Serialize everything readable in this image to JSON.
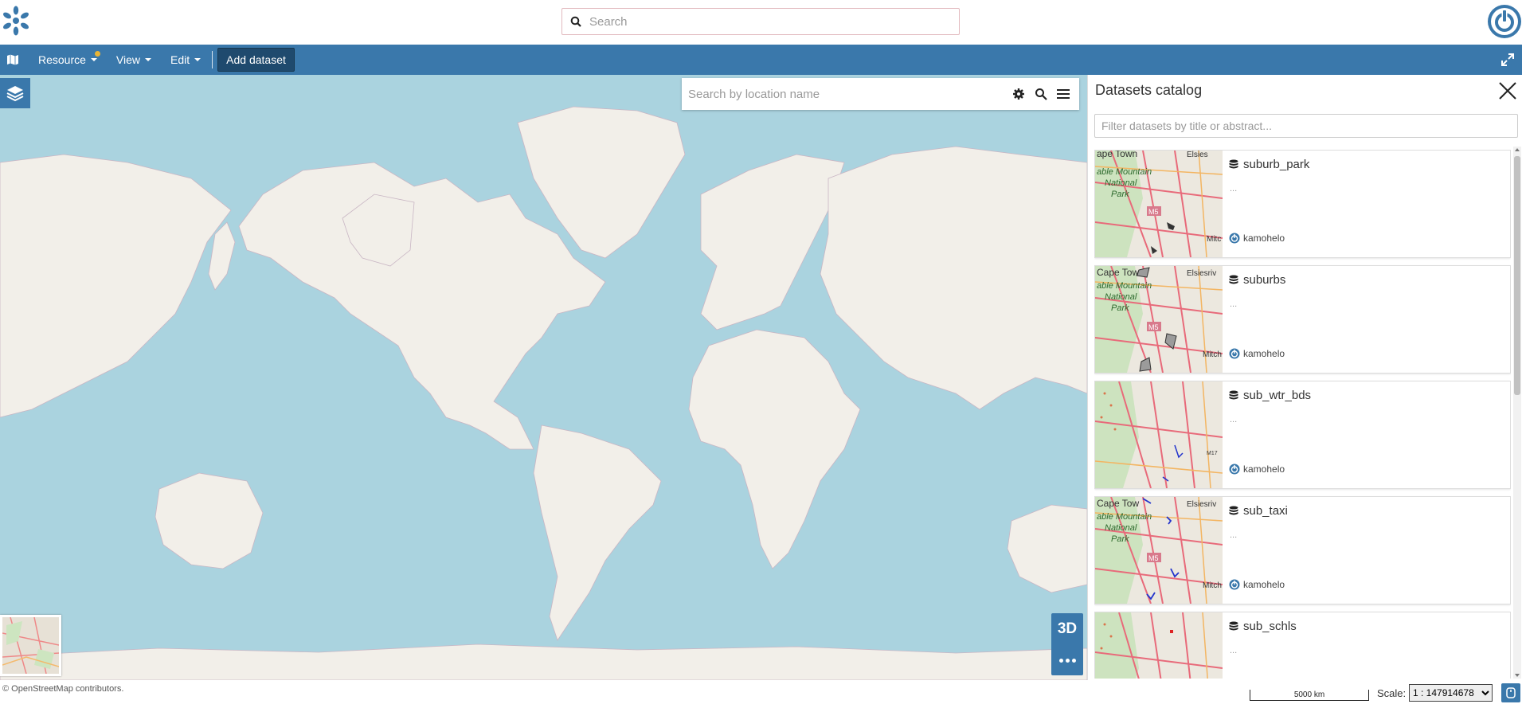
{
  "colors": {
    "brand": "#3a78ab",
    "ocean": "#aad3df",
    "land": "#f2efe9",
    "notification_dot": "#e9b435"
  },
  "header": {
    "search_placeholder": "Search",
    "logo_icon": "asterisk-logo-icon",
    "user_icon": "power-icon"
  },
  "toolbar": {
    "map_icon": "map-icon",
    "menus": [
      "Resource",
      "View",
      "Edit"
    ],
    "add_dataset": "Add dataset",
    "expand_icon": "expand-icon"
  },
  "map": {
    "location_search_placeholder": "Search by location name",
    "button_3d": "3D",
    "attribution": "© OpenStreetMap contributors."
  },
  "scale": {
    "bar_label": "5000 km",
    "label": "Scale:",
    "value": "1 : 147914678"
  },
  "catalog": {
    "title": "Datasets catalog",
    "filter_placeholder": "Filter datasets by title or abstract...",
    "items": [
      {
        "title": "suburb_park",
        "abstract": "...",
        "owner": "kamohelo"
      },
      {
        "title": "suburbs",
        "abstract": "...",
        "owner": "kamohelo"
      },
      {
        "title": "sub_wtr_bds",
        "abstract": "...",
        "owner": "kamohelo"
      },
      {
        "title": "sub_taxi",
        "abstract": "...",
        "owner": "kamohelo"
      },
      {
        "title": "sub_schls",
        "abstract": "...",
        "owner": ""
      }
    ]
  }
}
